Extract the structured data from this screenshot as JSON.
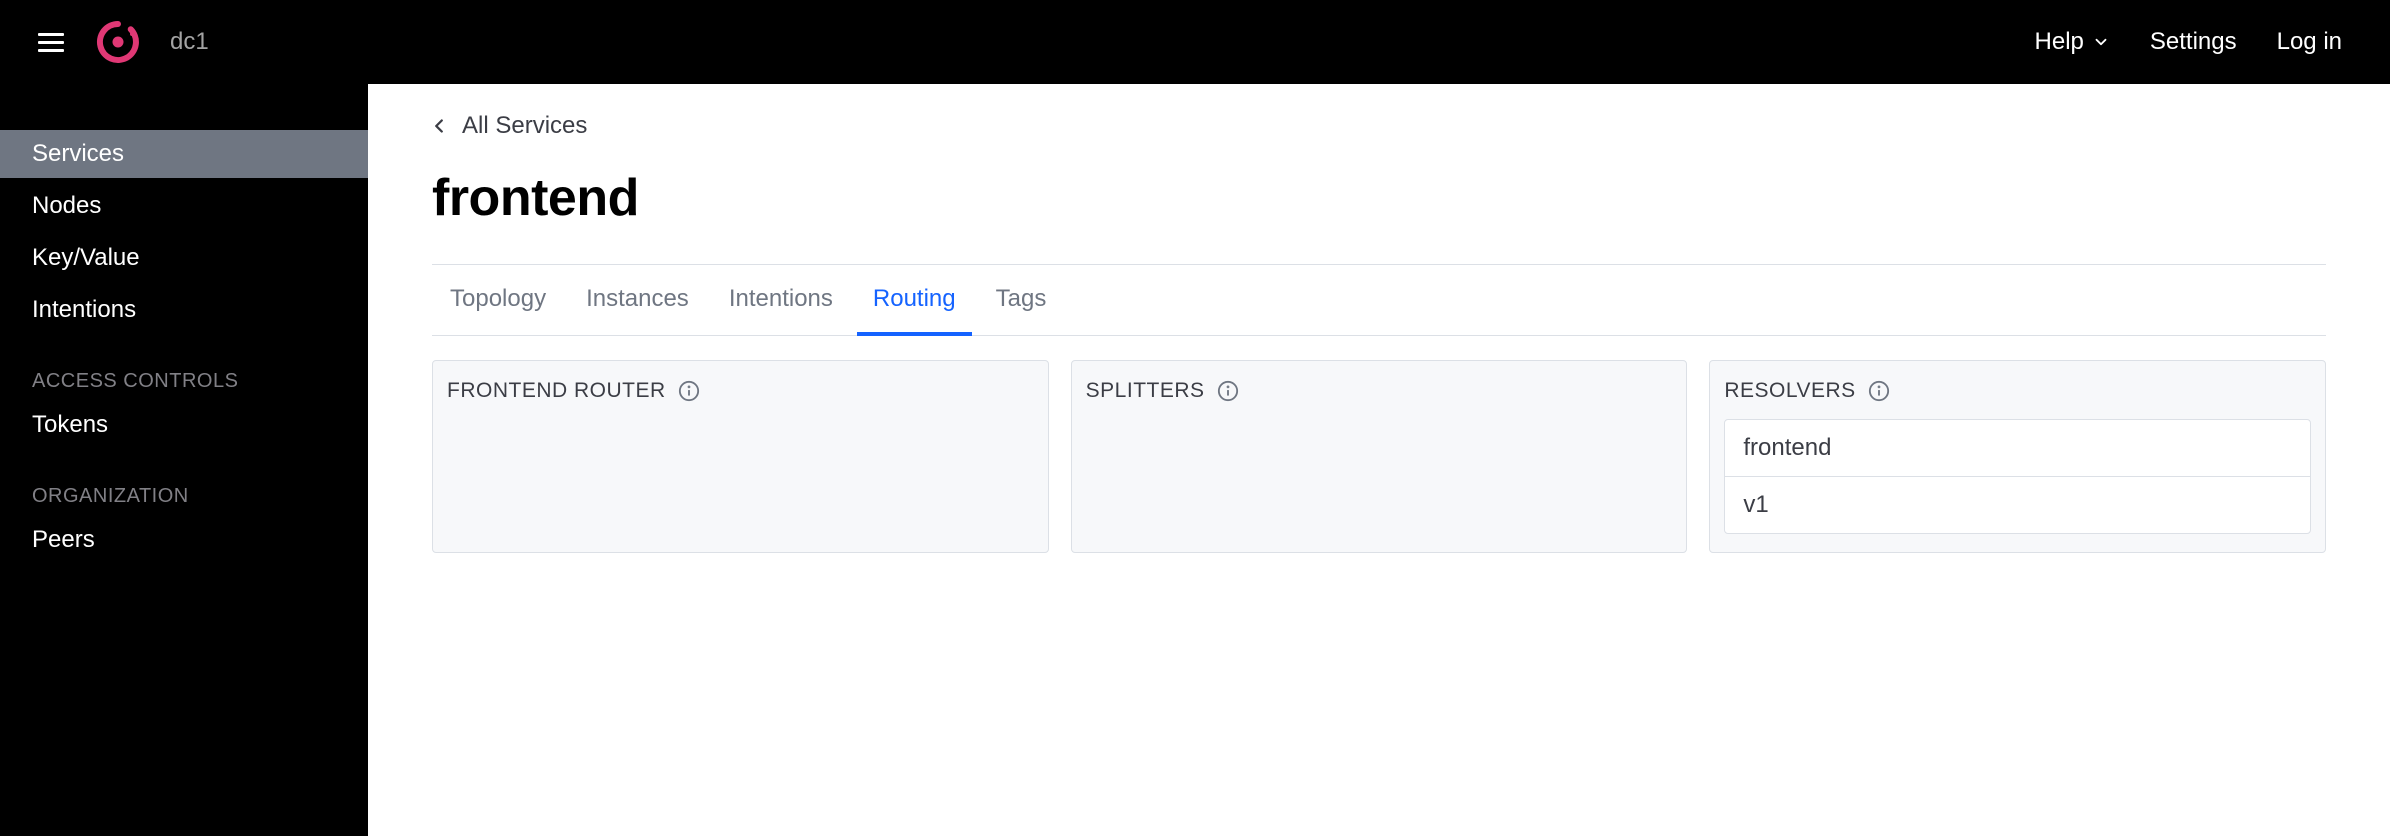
{
  "header": {
    "datacenter": "dc1",
    "nav": {
      "help": "Help",
      "settings": "Settings",
      "login": "Log in"
    }
  },
  "sidebar": {
    "items": [
      {
        "label": "Services",
        "active": true
      },
      {
        "label": "Nodes",
        "active": false
      },
      {
        "label": "Key/Value",
        "active": false
      },
      {
        "label": "Intentions",
        "active": false
      }
    ],
    "access_controls_heading": "ACCESS CONTROLS",
    "access_controls_items": [
      {
        "label": "Tokens"
      }
    ],
    "organization_heading": "ORGANIZATION",
    "organization_items": [
      {
        "label": "Peers"
      }
    ]
  },
  "breadcrumb": {
    "back_label": "All Services"
  },
  "page": {
    "title": "frontend"
  },
  "tabs": [
    {
      "label": "Topology",
      "active": false
    },
    {
      "label": "Instances",
      "active": false
    },
    {
      "label": "Intentions",
      "active": false
    },
    {
      "label": "Routing",
      "active": true
    },
    {
      "label": "Tags",
      "active": false
    }
  ],
  "routing": {
    "router_card": {
      "title": "FRONTEND ROUTER"
    },
    "splitters_card": {
      "title": "SPLITTERS"
    },
    "resolvers_card": {
      "title": "RESOLVERS",
      "items": [
        "frontend",
        "v1"
      ]
    }
  },
  "colors": {
    "accent": "#1563ff",
    "brand": "#e03875"
  }
}
